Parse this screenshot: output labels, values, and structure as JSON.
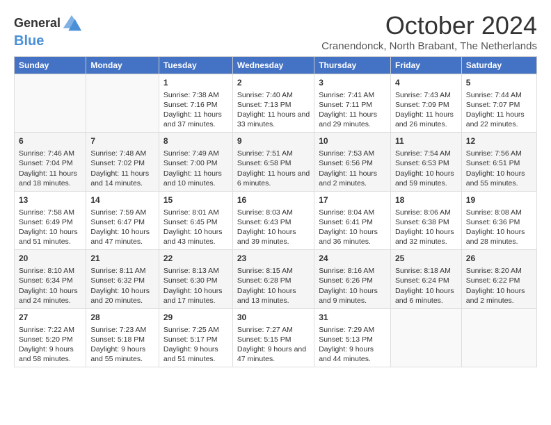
{
  "logo": {
    "line1": "General",
    "line2": "Blue"
  },
  "title": "October 2024",
  "subtitle": "Cranendonck, North Brabant, The Netherlands",
  "days_of_week": [
    "Sunday",
    "Monday",
    "Tuesday",
    "Wednesday",
    "Thursday",
    "Friday",
    "Saturday"
  ],
  "weeks": [
    [
      {
        "day": "",
        "content": ""
      },
      {
        "day": "",
        "content": ""
      },
      {
        "day": "1",
        "content": "Sunrise: 7:38 AM\nSunset: 7:16 PM\nDaylight: 11 hours and 37 minutes."
      },
      {
        "day": "2",
        "content": "Sunrise: 7:40 AM\nSunset: 7:13 PM\nDaylight: 11 hours and 33 minutes."
      },
      {
        "day": "3",
        "content": "Sunrise: 7:41 AM\nSunset: 7:11 PM\nDaylight: 11 hours and 29 minutes."
      },
      {
        "day": "4",
        "content": "Sunrise: 7:43 AM\nSunset: 7:09 PM\nDaylight: 11 hours and 26 minutes."
      },
      {
        "day": "5",
        "content": "Sunrise: 7:44 AM\nSunset: 7:07 PM\nDaylight: 11 hours and 22 minutes."
      }
    ],
    [
      {
        "day": "6",
        "content": "Sunrise: 7:46 AM\nSunset: 7:04 PM\nDaylight: 11 hours and 18 minutes."
      },
      {
        "day": "7",
        "content": "Sunrise: 7:48 AM\nSunset: 7:02 PM\nDaylight: 11 hours and 14 minutes."
      },
      {
        "day": "8",
        "content": "Sunrise: 7:49 AM\nSunset: 7:00 PM\nDaylight: 11 hours and 10 minutes."
      },
      {
        "day": "9",
        "content": "Sunrise: 7:51 AM\nSunset: 6:58 PM\nDaylight: 11 hours and 6 minutes."
      },
      {
        "day": "10",
        "content": "Sunrise: 7:53 AM\nSunset: 6:56 PM\nDaylight: 11 hours and 2 minutes."
      },
      {
        "day": "11",
        "content": "Sunrise: 7:54 AM\nSunset: 6:53 PM\nDaylight: 10 hours and 59 minutes."
      },
      {
        "day": "12",
        "content": "Sunrise: 7:56 AM\nSunset: 6:51 PM\nDaylight: 10 hours and 55 minutes."
      }
    ],
    [
      {
        "day": "13",
        "content": "Sunrise: 7:58 AM\nSunset: 6:49 PM\nDaylight: 10 hours and 51 minutes."
      },
      {
        "day": "14",
        "content": "Sunrise: 7:59 AM\nSunset: 6:47 PM\nDaylight: 10 hours and 47 minutes."
      },
      {
        "day": "15",
        "content": "Sunrise: 8:01 AM\nSunset: 6:45 PM\nDaylight: 10 hours and 43 minutes."
      },
      {
        "day": "16",
        "content": "Sunrise: 8:03 AM\nSunset: 6:43 PM\nDaylight: 10 hours and 39 minutes."
      },
      {
        "day": "17",
        "content": "Sunrise: 8:04 AM\nSunset: 6:41 PM\nDaylight: 10 hours and 36 minutes."
      },
      {
        "day": "18",
        "content": "Sunrise: 8:06 AM\nSunset: 6:38 PM\nDaylight: 10 hours and 32 minutes."
      },
      {
        "day": "19",
        "content": "Sunrise: 8:08 AM\nSunset: 6:36 PM\nDaylight: 10 hours and 28 minutes."
      }
    ],
    [
      {
        "day": "20",
        "content": "Sunrise: 8:10 AM\nSunset: 6:34 PM\nDaylight: 10 hours and 24 minutes."
      },
      {
        "day": "21",
        "content": "Sunrise: 8:11 AM\nSunset: 6:32 PM\nDaylight: 10 hours and 20 minutes."
      },
      {
        "day": "22",
        "content": "Sunrise: 8:13 AM\nSunset: 6:30 PM\nDaylight: 10 hours and 17 minutes."
      },
      {
        "day": "23",
        "content": "Sunrise: 8:15 AM\nSunset: 6:28 PM\nDaylight: 10 hours and 13 minutes."
      },
      {
        "day": "24",
        "content": "Sunrise: 8:16 AM\nSunset: 6:26 PM\nDaylight: 10 hours and 9 minutes."
      },
      {
        "day": "25",
        "content": "Sunrise: 8:18 AM\nSunset: 6:24 PM\nDaylight: 10 hours and 6 minutes."
      },
      {
        "day": "26",
        "content": "Sunrise: 8:20 AM\nSunset: 6:22 PM\nDaylight: 10 hours and 2 minutes."
      }
    ],
    [
      {
        "day": "27",
        "content": "Sunrise: 7:22 AM\nSunset: 5:20 PM\nDaylight: 9 hours and 58 minutes."
      },
      {
        "day": "28",
        "content": "Sunrise: 7:23 AM\nSunset: 5:18 PM\nDaylight: 9 hours and 55 minutes."
      },
      {
        "day": "29",
        "content": "Sunrise: 7:25 AM\nSunset: 5:17 PM\nDaylight: 9 hours and 51 minutes."
      },
      {
        "day": "30",
        "content": "Sunrise: 7:27 AM\nSunset: 5:15 PM\nDaylight: 9 hours and 47 minutes."
      },
      {
        "day": "31",
        "content": "Sunrise: 7:29 AM\nSunset: 5:13 PM\nDaylight: 9 hours and 44 minutes."
      },
      {
        "day": "",
        "content": ""
      },
      {
        "day": "",
        "content": ""
      }
    ]
  ]
}
